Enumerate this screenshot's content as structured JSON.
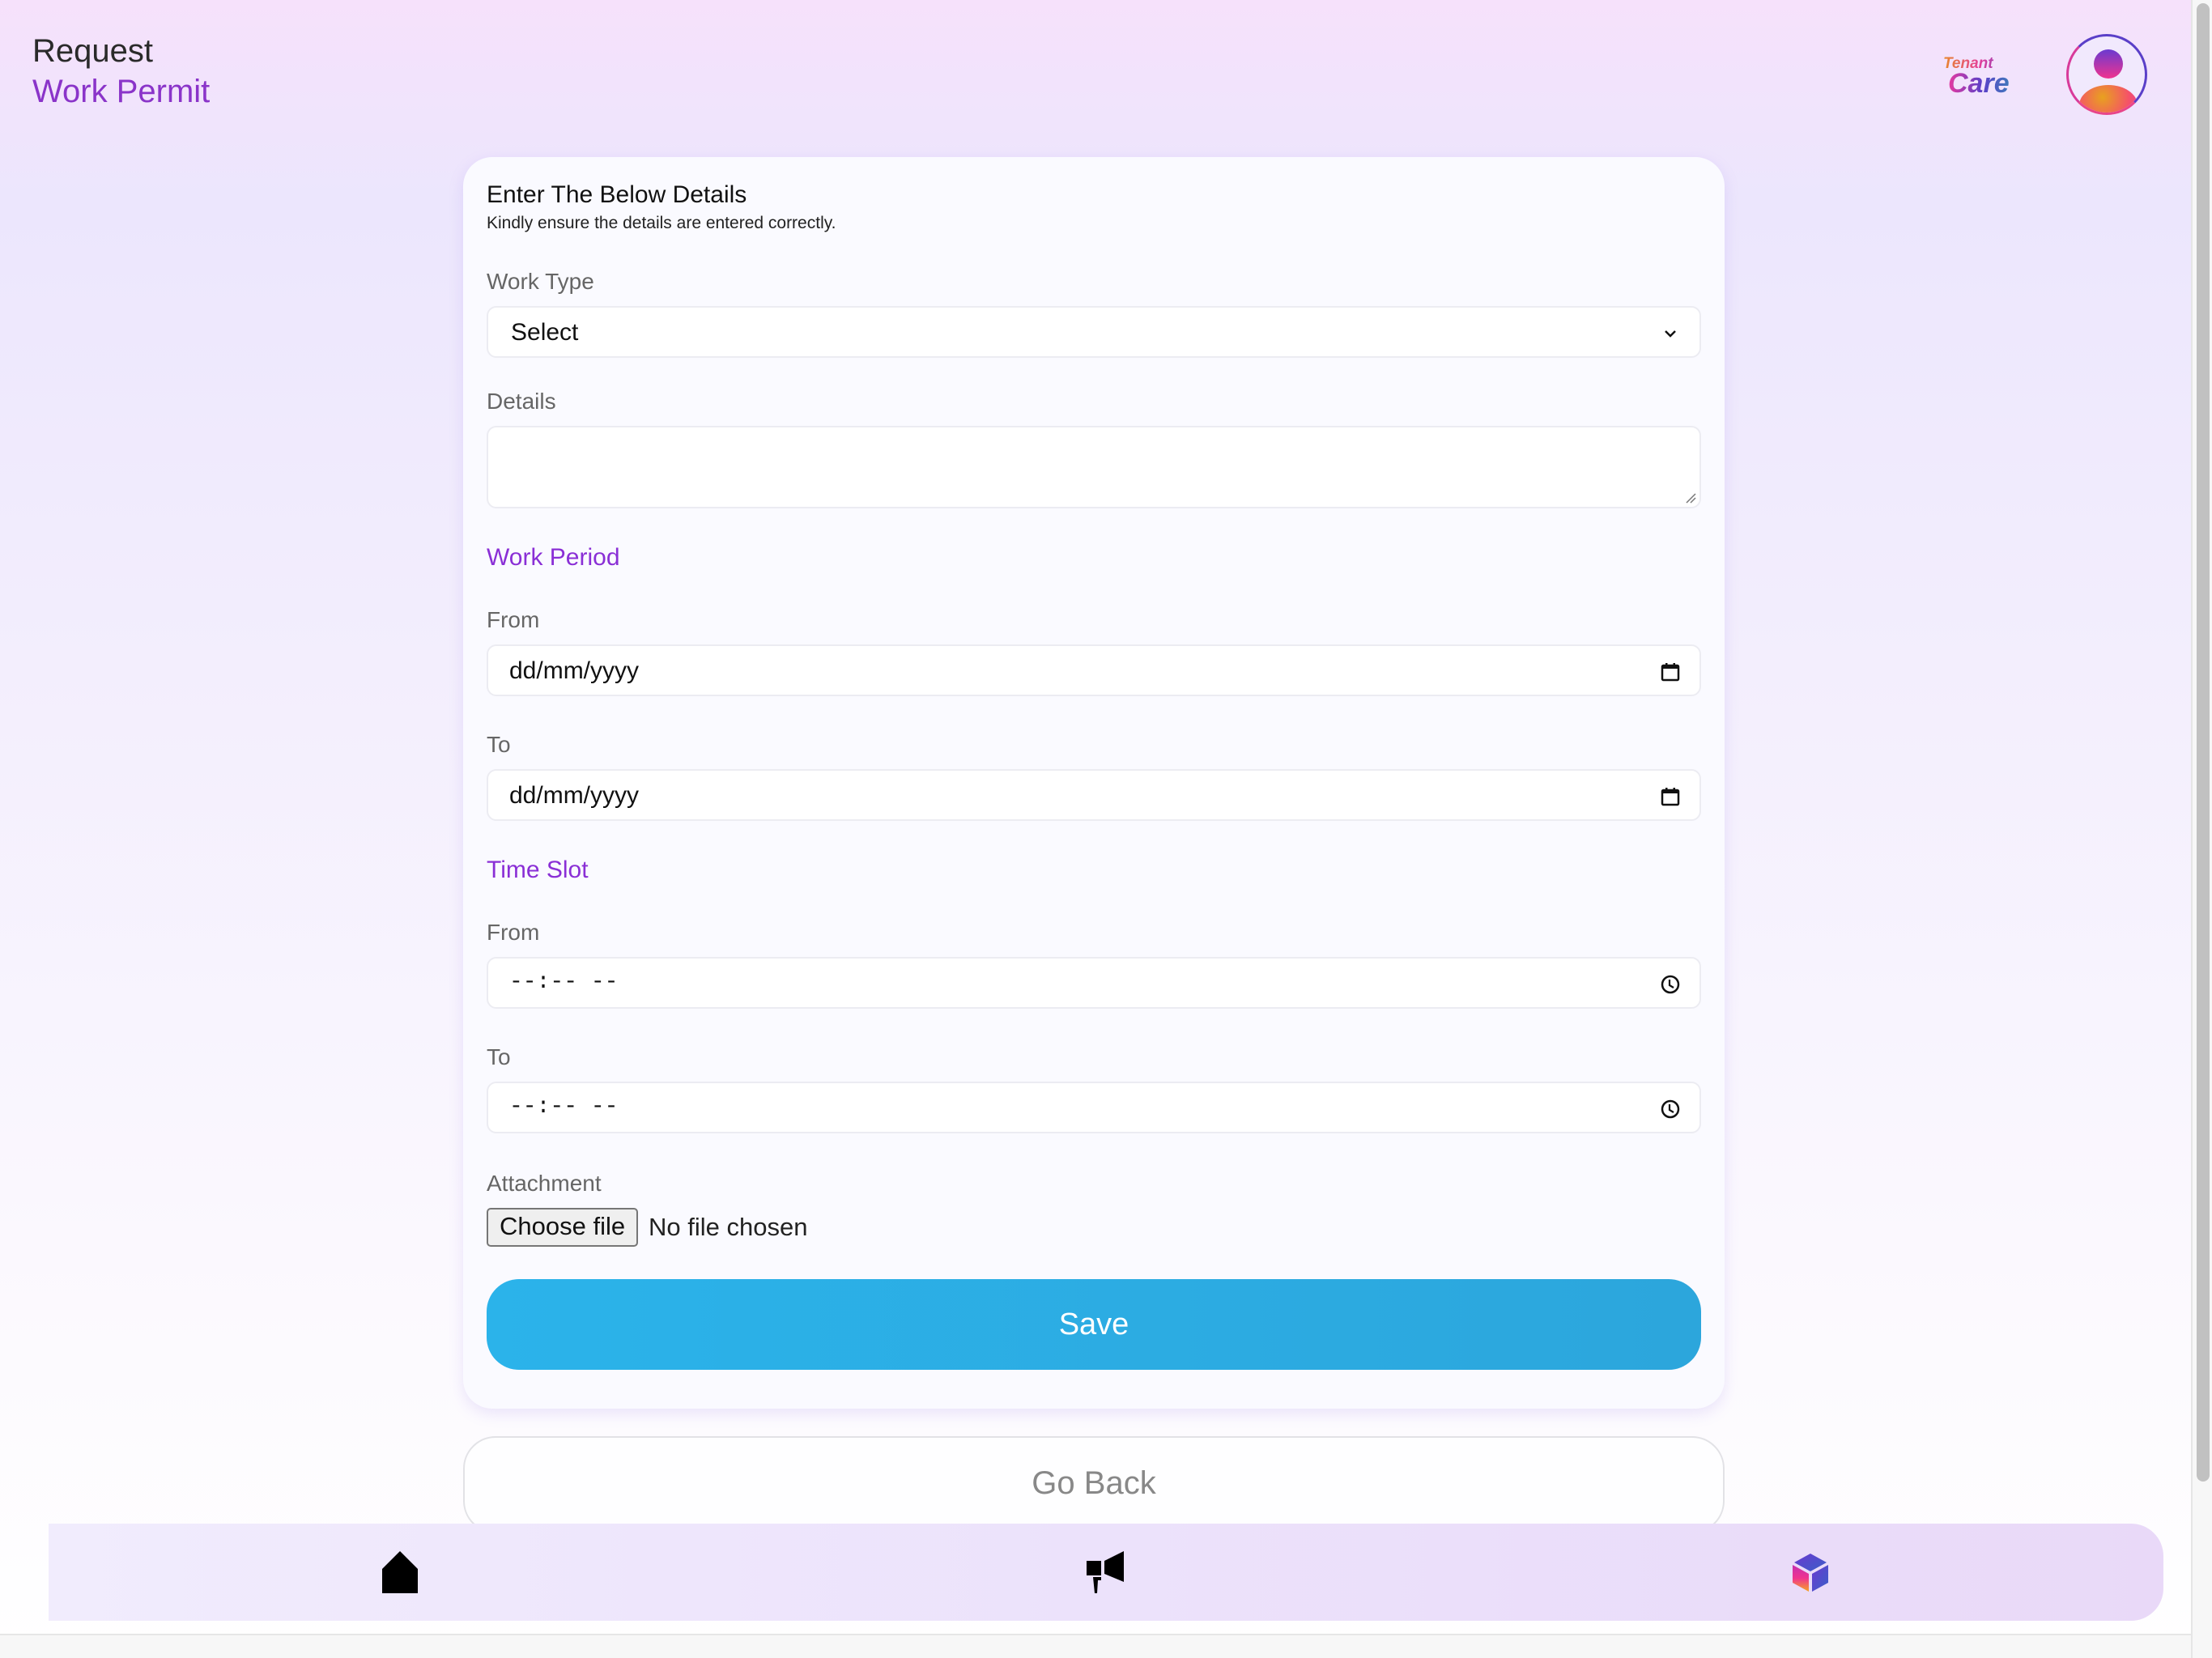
{
  "header": {
    "title_line1": "Request",
    "title_line2": "Work Permit",
    "brand_small": "Tenant",
    "brand_large": "Care",
    "accent_color": "#8a34c9"
  },
  "form": {
    "heading": "Enter The Below Details",
    "subheading": "Kindly ensure the details are entered correctly.",
    "work_type": {
      "label": "Work Type",
      "value": "Select"
    },
    "details": {
      "label": "Details",
      "value": ""
    },
    "work_period": {
      "section_label": "Work Period",
      "from": {
        "label": "From",
        "placeholder": "dd/mm/yyyy"
      },
      "to": {
        "label": "To",
        "placeholder": "dd/mm/yyyy"
      }
    },
    "time_slot": {
      "section_label": "Time Slot",
      "from": {
        "label": "From",
        "placeholder": "--:-- --"
      },
      "to": {
        "label": "To",
        "placeholder": "--:-- --"
      }
    },
    "attachment": {
      "label": "Attachment",
      "button_label": "Choose file",
      "status": "No file chosen"
    },
    "save_label": "Save",
    "save_color": "#2bb0e6"
  },
  "go_back_label": "Go Back",
  "bottom_nav": {
    "items": [
      {
        "icon": "home-icon"
      },
      {
        "icon": "megaphone-icon"
      },
      {
        "icon": "cube-icon"
      }
    ]
  }
}
